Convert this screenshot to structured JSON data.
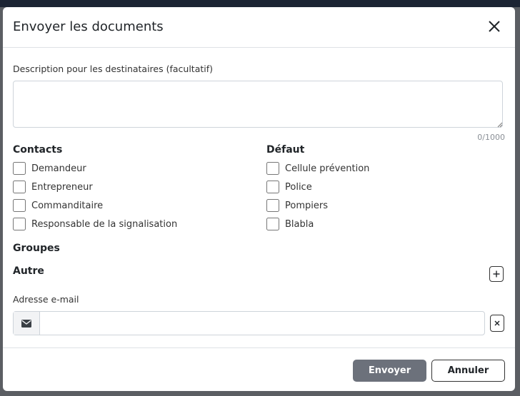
{
  "dialog": {
    "title": "Envoyer les documents",
    "close_icon": "close-icon"
  },
  "description": {
    "label": "Description pour les destinataires (facultatif)",
    "value": "",
    "counter": "0/1000"
  },
  "contacts": {
    "title": "Contacts",
    "items": [
      {
        "label": "Demandeur",
        "checked": false
      },
      {
        "label": "Entrepreneur",
        "checked": false
      },
      {
        "label": "Commanditaire",
        "checked": false
      },
      {
        "label": "Responsable de la signalisation",
        "checked": false
      }
    ]
  },
  "defaults": {
    "title": "Défaut",
    "items": [
      {
        "label": "Cellule prévention",
        "checked": false
      },
      {
        "label": "Police",
        "checked": false
      },
      {
        "label": "Pompiers",
        "checked": false
      },
      {
        "label": "Blabla",
        "checked": false
      }
    ]
  },
  "groups": {
    "title": "Groupes"
  },
  "other": {
    "title": "Autre",
    "add_icon": "plus-icon",
    "email_label": "Adresse e-mail",
    "email_icon": "envelope-icon",
    "email_value": "",
    "remove_icon": "x-icon"
  },
  "footer": {
    "send_label": "Envoyer",
    "cancel_label": "Annuler"
  },
  "colors": {
    "send_button": "#6c717b",
    "overlay": "#5b5e63",
    "topbar": "#1c2433"
  }
}
